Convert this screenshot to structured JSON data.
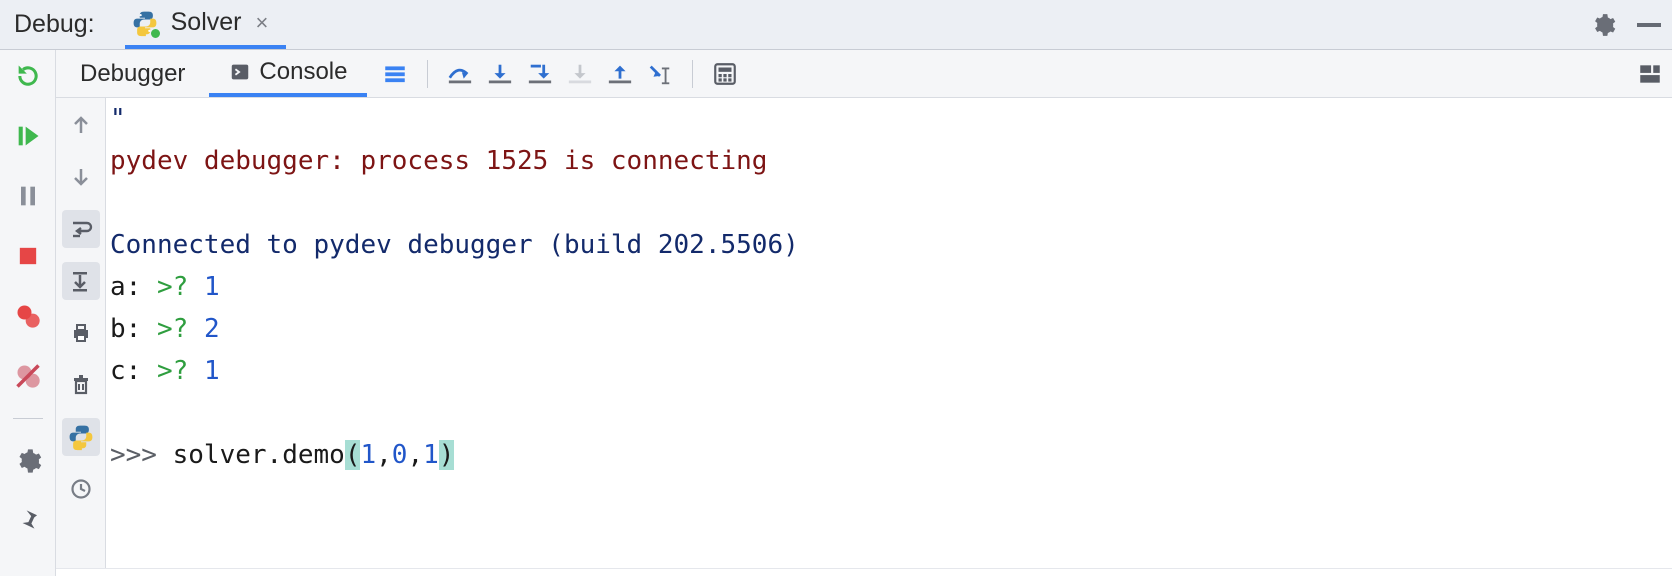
{
  "panel": {
    "label": "Debug:"
  },
  "run_tab": {
    "title": "Solver"
  },
  "toolbar_tabs": {
    "debugger": "Debugger",
    "console": "Console"
  },
  "console_output": {
    "line0": "\"",
    "connecting": "pydev debugger: process 1525 is connecting",
    "connected": "Connected to pydev debugger (build 202.5506)",
    "inputs": {
      "a": {
        "label": "a: ",
        "prompt": ">? ",
        "value": "1"
      },
      "b": {
        "label": "b: ",
        "prompt": ">? ",
        "value": "2"
      },
      "c": {
        "label": "c: ",
        "prompt": ">? ",
        "value": "1"
      }
    },
    "repl": {
      "prompt": ">>> ",
      "call_obj": "solver",
      "dot": ".",
      "call_fn": "demo",
      "open": "(",
      "arg1": "1",
      "comma1": ",",
      "arg2": "0",
      "comma2": ",",
      "arg3": "1",
      "close": ")"
    }
  }
}
